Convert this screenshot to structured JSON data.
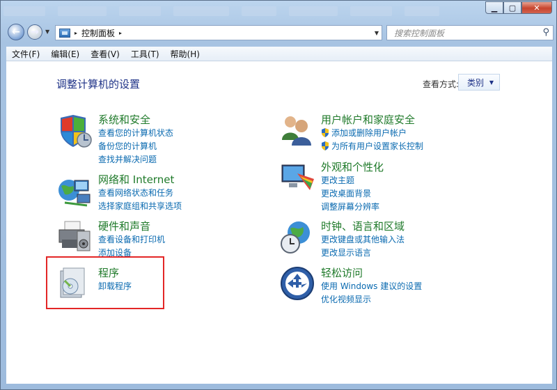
{
  "window": {
    "minimize_icon": "minimize-icon",
    "maximize_icon": "maximize-icon",
    "close_icon": "close-icon"
  },
  "nav": {
    "breadcrumb_sep": "▸",
    "address_items": [
      "控制面板"
    ],
    "search_placeholder": "搜索控制面板"
  },
  "menu": [
    "文件(F)",
    "编辑(E)",
    "查看(V)",
    "工具(T)",
    "帮助(H)"
  ],
  "content": {
    "heading": "调整计算机的设置",
    "view_by_label": "查看方式:",
    "view_by_value": "类别"
  },
  "categories": [
    {
      "title": "系统和安全",
      "icon": "shield-icon",
      "links": [
        "查看您的计算机状态",
        "备份您的计算机",
        "查找并解决问题"
      ]
    },
    {
      "title": "网络和 Internet",
      "icon": "network-globe-icon",
      "links": [
        "查看网络状态和任务",
        "选择家庭组和共享选项"
      ]
    },
    {
      "title": "硬件和声音",
      "icon": "printer-icon",
      "links": [
        "查看设备和打印机",
        "添加设备"
      ]
    },
    {
      "title": "程序",
      "icon": "programs-icon",
      "links": [
        "卸载程序"
      ]
    },
    {
      "title": "用户帐户和家庭安全",
      "icon": "users-icon",
      "links": [
        "添加或删除用户帐户",
        "为所有用户设置家长控制"
      ]
    },
    {
      "title": "外观和个性化",
      "icon": "monitor-palette-icon",
      "links": [
        "更改主题",
        "更改桌面背景",
        "调整屏幕分辨率"
      ]
    },
    {
      "title": "时钟、语言和区域",
      "icon": "globe-clock-icon",
      "links": [
        "更改键盘或其他输入法",
        "更改显示语言"
      ]
    },
    {
      "title": "轻松访问",
      "icon": "ease-of-access-icon",
      "links": [
        "使用 Windows 建议的设置",
        "优化视频显示"
      ]
    }
  ],
  "colors": {
    "category_title": "#1f7a2a",
    "link": "#0a6ab0",
    "heading": "#1e3287",
    "highlight": "#e32626"
  }
}
